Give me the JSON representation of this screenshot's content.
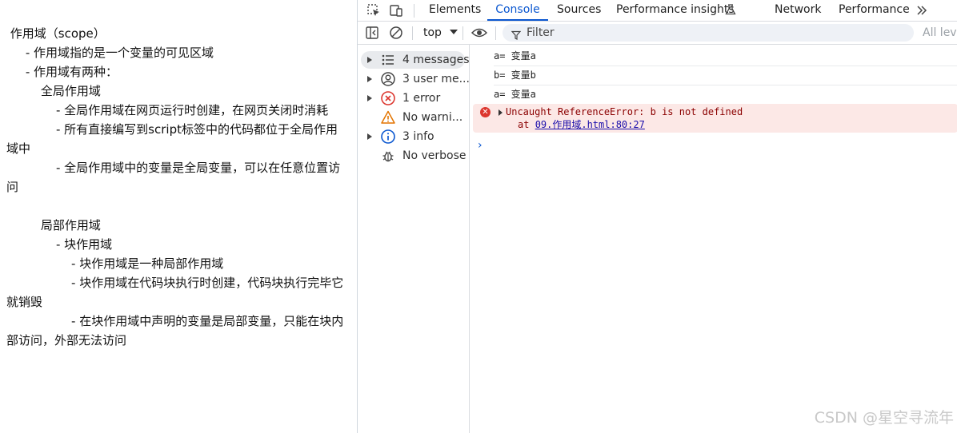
{
  "page": {
    "lines": [
      " 作用域（scope）",
      "     - 作用域指的是一个变量的可见区域",
      "     - 作用域有两种：",
      "         全局作用域",
      "             - 全局作用域在网页运行时创建，在网页关闭时消耗",
      "             - 所有直接编写到script标签中的代码都位于全局作用",
      "域中",
      "             - 全局作用域中的变量是全局变量，可以在任意位置访",
      "问",
      "",
      "         局部作用域",
      "             - 块作用域",
      "                 - 块作用域是一种局部作用域",
      "                 - 块作用域在代码块执行时创建，代码块执行完毕它",
      "就销毁",
      "                 - 在块作用域中声明的变量是局部变量，只能在块内",
      "部访问，外部无法访问"
    ]
  },
  "devtools": {
    "tabs": {
      "elements": "Elements",
      "console": "Console",
      "sources": "Sources",
      "performance_insights": "Performance insights",
      "network": "Network",
      "performance": "Performance"
    },
    "toolbar": {
      "context": "top",
      "filter_placeholder": "Filter",
      "levels": "All levels"
    },
    "sidebar": {
      "items": [
        {
          "label": "4 messages",
          "icon": "list-icon"
        },
        {
          "label": "3 user me...",
          "icon": "user-icon"
        },
        {
          "label": "1 error",
          "icon": "error-icon"
        },
        {
          "label": "No warni...",
          "icon": "warning-icon"
        },
        {
          "label": "3 info",
          "icon": "info-icon"
        },
        {
          "label": "No verbose",
          "icon": "bug-icon"
        }
      ]
    },
    "console": {
      "logs": [
        "a= 变量a",
        "b= 变量b",
        "a= 变量a"
      ],
      "error": {
        "message": "Uncaught ReferenceError: b is not defined",
        "at_prefix": "at ",
        "location": "09.作用域.html:80:27"
      },
      "prompt": "›"
    }
  },
  "watermark": "CSDN @星空寻流年",
  "colors": {
    "accent": "#0b57d0",
    "error_bg": "#fce8e6",
    "error_text": "#8b0000",
    "error_icon": "#dc362e"
  }
}
